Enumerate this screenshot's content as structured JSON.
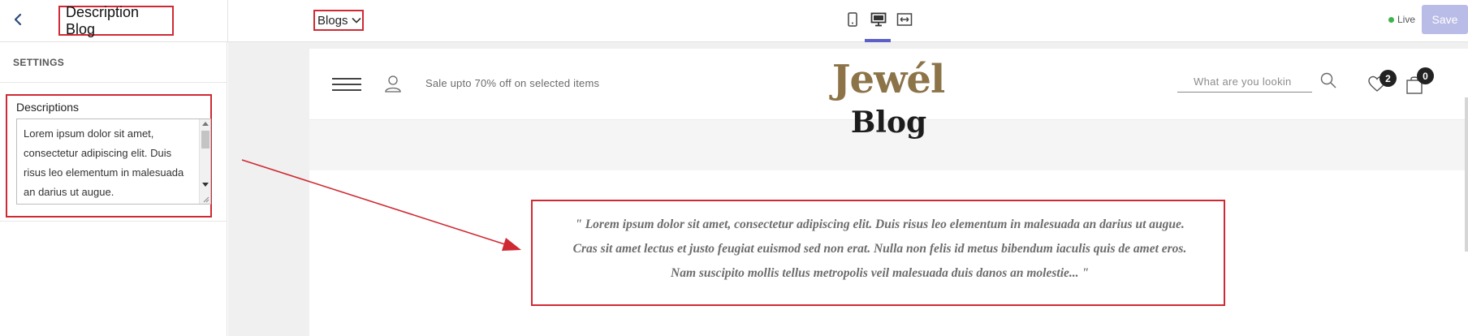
{
  "topbar": {
    "title": "Description Blog",
    "page_select": "Blogs",
    "live_label": "Live",
    "save_label": "Save",
    "accent_color": "#5b5fc7"
  },
  "sidebar": {
    "section_title": "SETTINGS",
    "field_label": "Descriptions",
    "field_value": "Lorem ipsum dolor sit amet, consectetur adipiscing elit. Duis risus leo elementum in malesuada an darius ut augue."
  },
  "site": {
    "promo": "Sale upto 70% off on selected items",
    "logo": "Jewél",
    "search_placeholder": "What are you lookin",
    "wishlist_count": "2",
    "cart_count": "0",
    "page_heading": "Blog",
    "description": "\" Lorem ipsum dolor sit amet, consectetur adipiscing elit. Duis risus leo elementum in malesuada an darius ut augue. Cras sit amet lectus et justo feugiat euismod sed non erat. Nulla non felis id metus bibendum iaculis quis de amet eros. Nam suscipito mollis tellus metropolis veil malesuada duis danos an molestie... \""
  },
  "colors": {
    "highlight": "#cf2a33",
    "logo": "#8c7348",
    "live_dot": "#3cb44b",
    "save_button": "#b9bce6"
  }
}
